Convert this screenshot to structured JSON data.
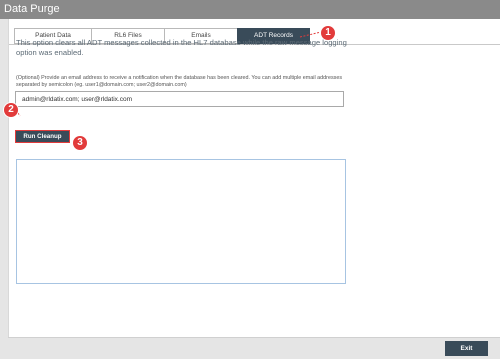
{
  "window": {
    "title": "Data Purge"
  },
  "tabs": [
    {
      "label": "Patient Data",
      "active": false
    },
    {
      "label": "RL6 Files",
      "active": false
    },
    {
      "label": "Emails",
      "active": false
    },
    {
      "label": "ADT Records",
      "active": true
    }
  ],
  "description": "This option clears all ADT messages collected in the HL7 database while the raw message logging option was enabled.",
  "email": {
    "label": "(Optional) Provide an email address to receive a notification when the database has been cleared. You can add multiple email addresses separated by semicolon (eg. user1@domain.com; user2@domain.com)",
    "value": "admin@rldatix.com; user@rldatix.com"
  },
  "run_cleanup_label": "Run Cleanup",
  "output": {
    "value": ""
  },
  "exit_label": "Exit",
  "callouts": [
    "1",
    "2",
    "3"
  ],
  "colors": {
    "accent": "#394b59",
    "callout": "#e23b3b",
    "titlebar": "#8a8a8a",
    "description_text": "#5d6b76"
  }
}
